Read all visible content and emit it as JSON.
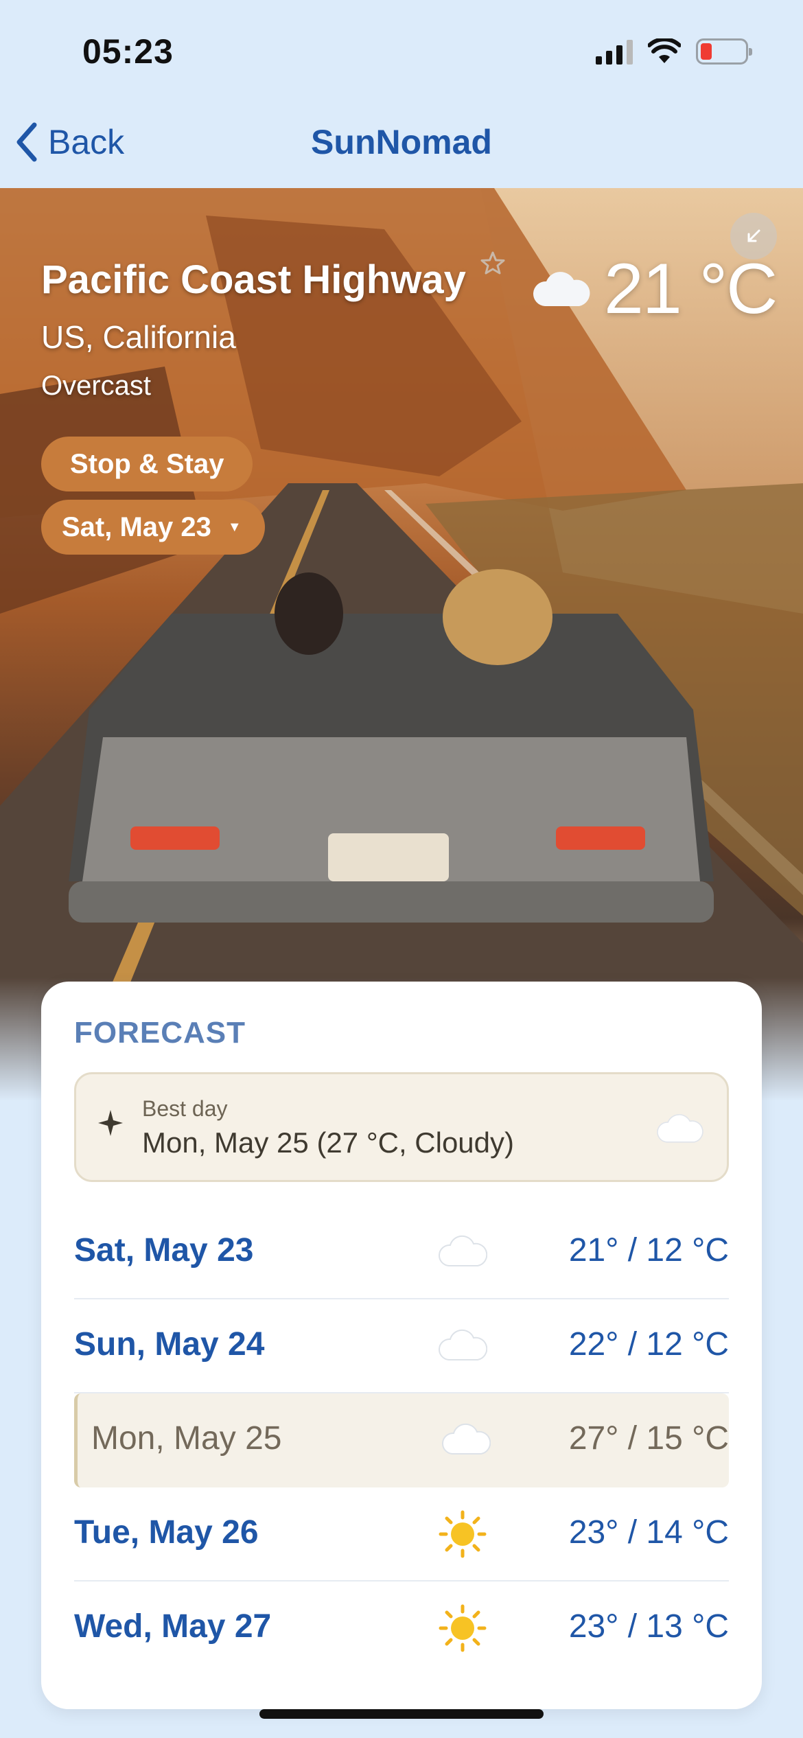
{
  "status": {
    "time": "05:23"
  },
  "nav": {
    "back_label": "Back",
    "title": "SunNomad"
  },
  "place": {
    "name": "Pacific Coast Highway",
    "region": "US, California",
    "condition": "Overcast",
    "temperature": "21 °C",
    "icon": "cloud-icon"
  },
  "actions": {
    "stop_label": "Stop & Stay",
    "date_label": "Sat, May 23"
  },
  "forecast": {
    "heading": "FORECAST",
    "best_day": {
      "label": "Best day",
      "value": "Mon, May 25 (27 °C, Cloudy)",
      "icon": "cloud-icon"
    },
    "days": [
      {
        "date": "Sat, May 23",
        "icon": "cloud-icon",
        "temp": "21° / 12 °C"
      },
      {
        "date": "Sun, May 24",
        "icon": "cloud-icon",
        "temp": "22° / 12 °C"
      },
      {
        "date": "Mon, May 25",
        "icon": "cloud-icon",
        "temp": "27° / 15 °C",
        "highlighted": true
      },
      {
        "date": "Tue, May 26",
        "icon": "sun-icon",
        "temp": "23° / 14 °C"
      },
      {
        "date": "Wed, May 27",
        "icon": "sun-icon",
        "temp": "23° / 13 °C"
      }
    ]
  },
  "colors": {
    "accent": "#1f56a7",
    "pill": "#c77c3c",
    "highlight": "#f5f1e8"
  }
}
